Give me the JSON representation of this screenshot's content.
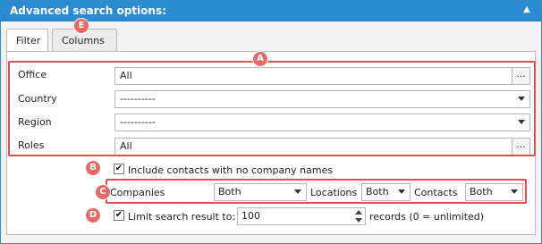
{
  "window": {
    "title": "Advanced search options:",
    "collapse_icon": "double-chevron-up"
  },
  "tabs": [
    {
      "label": "Filter",
      "active": true
    },
    {
      "label": "Columns",
      "active": false
    }
  ],
  "filter": {
    "office": {
      "label": "Office",
      "value": "All",
      "button": "..."
    },
    "country": {
      "label": "Country",
      "value": "----------"
    },
    "region": {
      "label": "Region",
      "value": "----------"
    },
    "roles": {
      "label": "Roles",
      "value": "All",
      "button": "..."
    }
  },
  "options": {
    "include_no_company": {
      "label": "Include contacts with no company names",
      "checked": true
    },
    "companies": {
      "label": "Companies",
      "value": "Both"
    },
    "locations": {
      "label": "Locations",
      "value": "Both"
    },
    "contacts": {
      "label": "Contacts",
      "value": "Both"
    },
    "limit": {
      "label": "Limit search result to:",
      "checked": true,
      "value": "100",
      "suffix": "records (0 = unlimited)"
    }
  },
  "markers": {
    "a": "A",
    "b": "B",
    "c": "C",
    "d": "D",
    "e": "E"
  },
  "colors": {
    "header": "#2c8ad1",
    "annotation": "#e14f4f",
    "marker": "#e56a6a"
  }
}
